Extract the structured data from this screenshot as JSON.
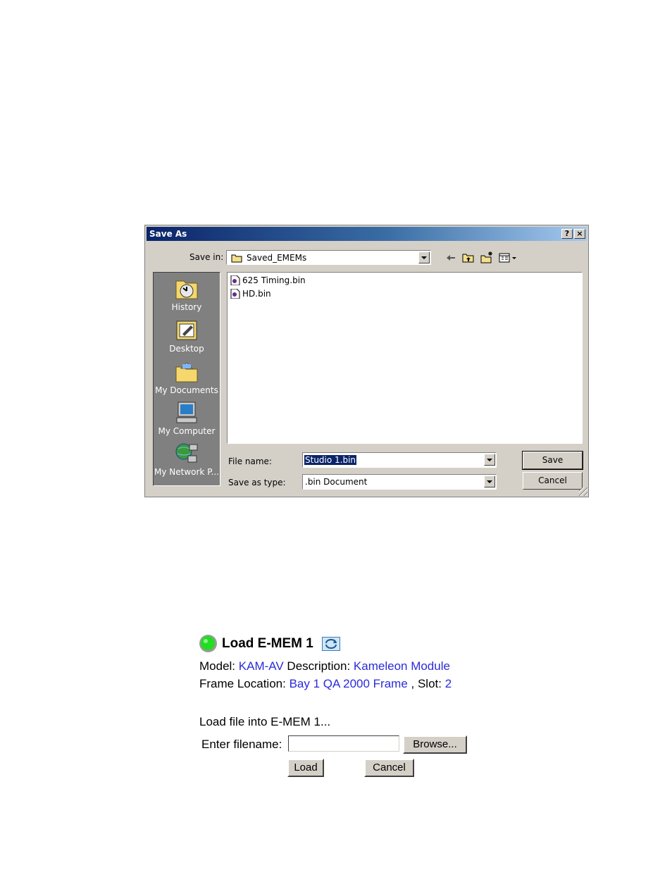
{
  "dialog": {
    "title": "Save As",
    "help_glyph": "?",
    "close_glyph": "×",
    "save_in_label": "Save in:",
    "save_in_value": "Saved_EMEMs",
    "toolbar_icons": [
      "back-arrow-icon",
      "up-folder-icon",
      "new-folder-icon",
      "view-menu-icon"
    ],
    "places": [
      {
        "label": "History",
        "icon": "history-icon"
      },
      {
        "label": "Desktop",
        "icon": "desktop-icon"
      },
      {
        "label": "My Documents",
        "icon": "my-documents-icon"
      },
      {
        "label": "My Computer",
        "icon": "my-computer-icon"
      },
      {
        "label": "My Network P...",
        "icon": "my-network-places-icon"
      }
    ],
    "files": [
      {
        "name": "625 Timing.bin",
        "icon": "bin-file-icon"
      },
      {
        "name": "HD.bin",
        "icon": "bin-file-icon"
      }
    ],
    "file_name_label": "File name:",
    "file_name_value": "Studio 1.bin",
    "save_as_type_label": "Save as type:",
    "save_as_type_value": ".bin Document",
    "save_button": "Save",
    "cancel_button": "Cancel",
    "colors": {
      "title_bar": "#0a246a",
      "face": "#d4d0c8",
      "places_bg": "#808080"
    }
  },
  "emem": {
    "title": "Load E-MEM 1",
    "status_color": "#22dd22",
    "model_label": "Model:",
    "model_value": "KAM-AV",
    "description_label": "Description:",
    "description_value": "Kameleon Module",
    "frame_location_label": "Frame Location:",
    "frame_location_value": "Bay 1 QA 2000 Frame",
    "slot_label": ", Slot:",
    "slot_value": "2",
    "load_prompt": "Load file into E-MEM 1...",
    "enter_filename_label": "Enter filename:",
    "filename_value": "",
    "browse_button": "Browse...",
    "load_button": "Load",
    "cancel_button": "Cancel",
    "link_color": "#2b2bd9"
  }
}
